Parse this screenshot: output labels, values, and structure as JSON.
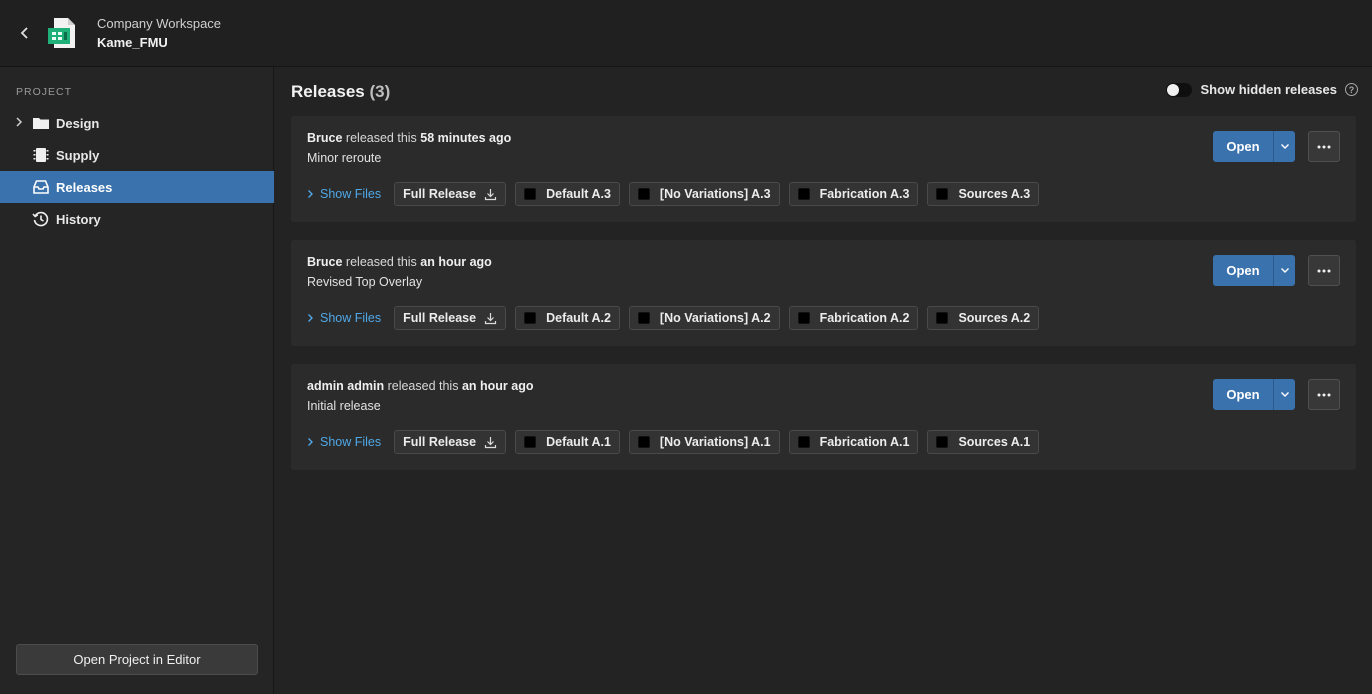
{
  "header": {
    "workspace": "Company Workspace",
    "project": "Kame_FMU"
  },
  "sidebar": {
    "section": "PROJECT",
    "items": [
      {
        "label": "Design",
        "icon": "folder-icon"
      },
      {
        "label": "Supply",
        "icon": "chip-icon"
      },
      {
        "label": "Releases",
        "icon": "inbox-icon",
        "active": true
      },
      {
        "label": "History",
        "icon": "history-icon"
      }
    ],
    "open_editor": "Open Project in Editor"
  },
  "main": {
    "title": "Releases",
    "count": "(3)",
    "toggle_label": "Show hidden releases",
    "help": "?",
    "releases": [
      {
        "author": "Bruce",
        "verb": "released this",
        "time": "58 minutes ago",
        "description": "Minor reroute",
        "show_files": "Show Files",
        "files": [
          "Full Release",
          "Default A.3",
          "[No Variations] A.3",
          "Fabrication A.3",
          "Sources A.3"
        ],
        "open_label": "Open"
      },
      {
        "author": "Bruce",
        "verb": "released this",
        "time": "an hour ago",
        "description": "Revised Top Overlay",
        "show_files": "Show Files",
        "files": [
          "Full Release",
          "Default A.2",
          "[No Variations] A.2",
          "Fabrication A.2",
          "Sources A.2"
        ],
        "open_label": "Open"
      },
      {
        "author": "admin admin",
        "verb": "released this",
        "time": "an hour ago",
        "description": "Initial release",
        "show_files": "Show Files",
        "files": [
          "Full Release",
          "Default A.1",
          "[No Variations] A.1",
          "Fabrication A.1",
          "Sources A.1"
        ],
        "open_label": "Open"
      }
    ]
  },
  "colors": {
    "accent": "#3a72ad",
    "link": "#4fa8e8",
    "logo": "#1fb07a"
  }
}
